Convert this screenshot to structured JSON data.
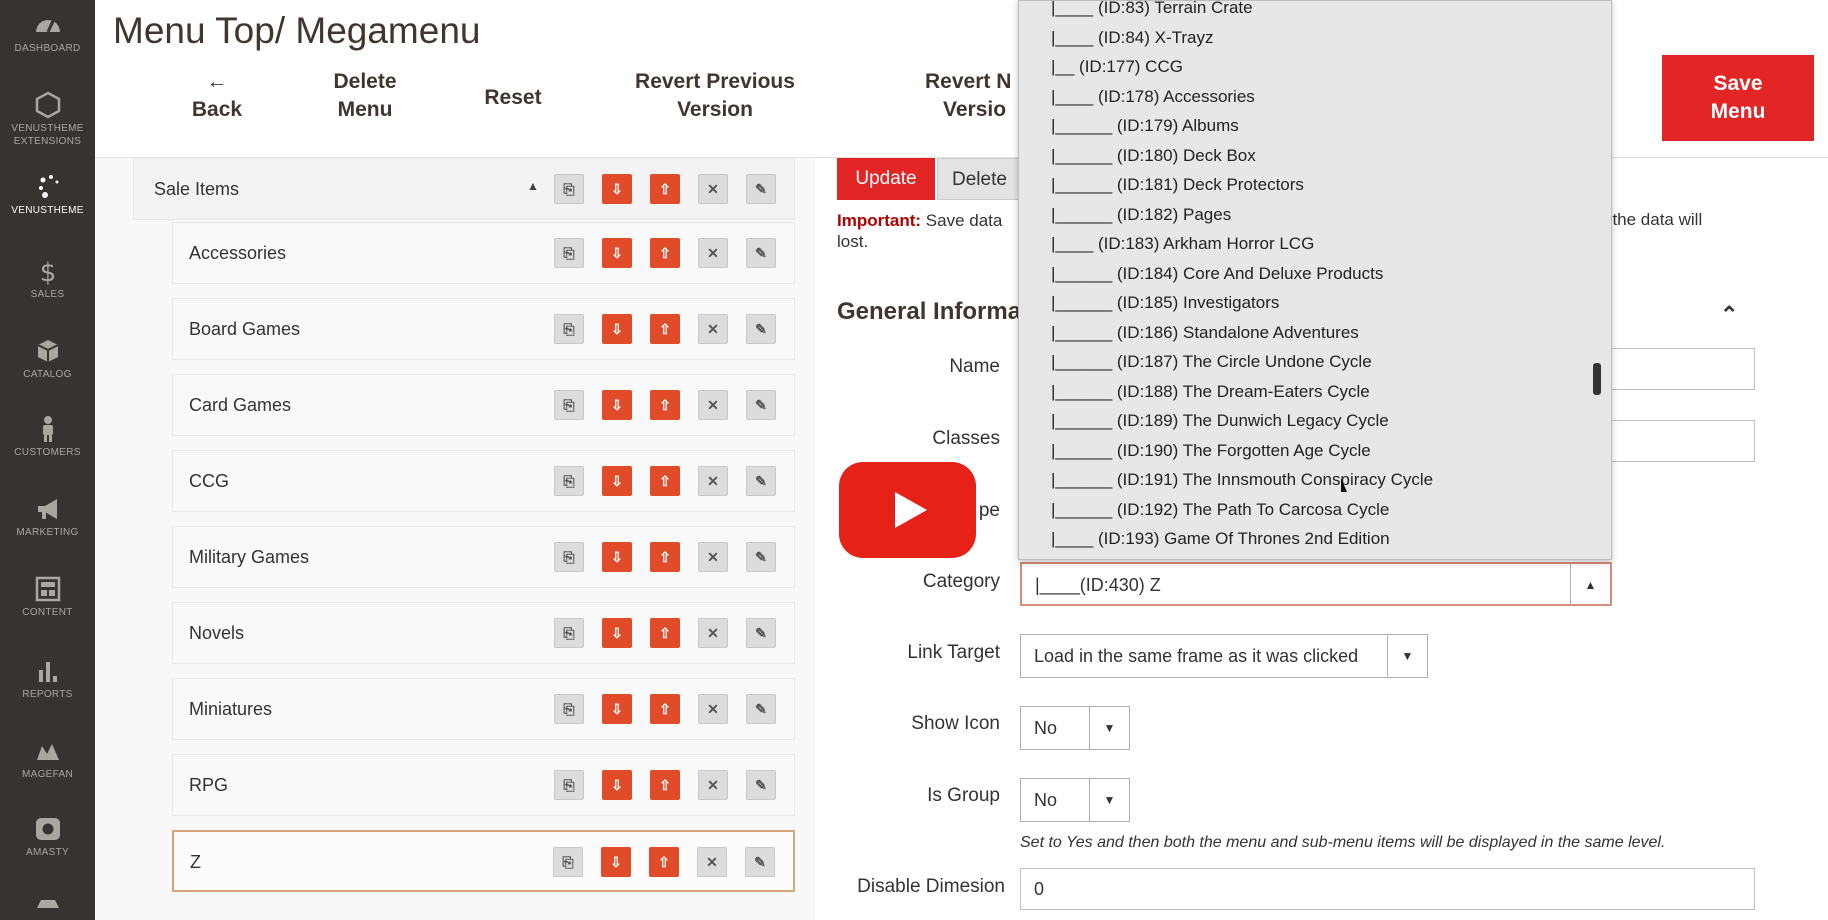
{
  "sidebar": {
    "items": [
      {
        "label": "DASHBOARD",
        "icon": "dashboard-icon"
      },
      {
        "label": "VENUSTHEME EXTENSIONS",
        "icon": "hexagon-icon"
      },
      {
        "label": "VENUSTHEME",
        "icon": "venustheme-icon"
      },
      {
        "label": "SALES",
        "icon": "dollar-icon"
      },
      {
        "label": "CATALOG",
        "icon": "box-icon"
      },
      {
        "label": "CUSTOMERS",
        "icon": "person-icon"
      },
      {
        "label": "MARKETING",
        "icon": "megaphone-icon"
      },
      {
        "label": "CONTENT",
        "icon": "layout-icon"
      },
      {
        "label": "REPORTS",
        "icon": "bar-chart-icon"
      },
      {
        "label": "MAGEFAN",
        "icon": "magefan-icon"
      },
      {
        "label": "AMASTY",
        "icon": "amasty-icon"
      }
    ]
  },
  "header": {
    "title": "Menu Top/ Megamenu",
    "back": {
      "arrow": "←",
      "label": "Back"
    },
    "delete_menu": [
      "Delete",
      "Menu"
    ],
    "reset": "Reset",
    "revert_previous": [
      "Revert Previous",
      "Version"
    ],
    "revert_next": [
      "Revert N",
      "Versio"
    ],
    "save_menu": [
      "Save",
      "Menu"
    ]
  },
  "tree": {
    "parent": {
      "label": "Sale Items",
      "caret": "▲"
    },
    "children": [
      "Accessories",
      "Board Games",
      "Card Games",
      "CCG",
      "Military Games",
      "Novels",
      "Miniatures",
      "RPG",
      "Z"
    ],
    "selected": "Z"
  },
  "form": {
    "update_label": "Update",
    "delete_label": "Delete",
    "important_label": "Important:",
    "important_text": " Save data",
    "important_text2": "lost.",
    "important_tail": ", the data will",
    "section_title": "General Informa",
    "collapse_glyph": "⌃",
    "fields": {
      "name_label": "Name",
      "classes_label": "Classes",
      "type_label_partial": "pe",
      "category_label": "Category",
      "category_value": "|____(ID:430) Z",
      "link_target_label": "Link Target",
      "link_target_value": "Load in the same frame as it was clicked",
      "show_icon_label": "Show Icon",
      "show_icon_value": "No",
      "is_group_label": "Is Group",
      "is_group_value": "No",
      "is_group_note": "Set to Yes and then both the menu and sub-menu items will be displayed in the same level.",
      "disable_dimesion_label": "Disable Dimesion",
      "disable_dimesion_value": "0"
    }
  },
  "dropdown": {
    "options": [
      "|____ (ID:83) Terrain Crate",
      "|____ (ID:84) X-Trayz",
      "|__ (ID:177) CCG",
      "|____ (ID:178) Accessories",
      "|______ (ID:179) Albums",
      "|______ (ID:180) Deck Box",
      "|______ (ID:181) Deck Protectors",
      "|______ (ID:182) Pages",
      "|____ (ID:183) Arkham Horror LCG",
      "|______ (ID:184) Core And Deluxe Products",
      "|______ (ID:185) Investigators",
      "|______ (ID:186) Standalone Adventures",
      "|______ (ID:187) The Circle Undone Cycle",
      "|______ (ID:188) The Dream-Eaters Cycle",
      "|______ (ID:189) The Dunwich Legacy Cycle",
      "|______ (ID:190) The Forgotten Age Cycle",
      "|______ (ID:191) The Innsmouth Conspiracy Cycle",
      "|______ (ID:192) The Path To Carcosa Cycle",
      "|____ (ID:193) Game Of Thrones 2nd Edition"
    ],
    "indent_levels": [
      2,
      2,
      1,
      2,
      3,
      3,
      3,
      3,
      2,
      3,
      3,
      3,
      3,
      3,
      3,
      3,
      3,
      3,
      2
    ]
  },
  "colors": {
    "accent_red": "#e22626",
    "sidebar_bg": "#373330",
    "play_red": "#e62117"
  }
}
